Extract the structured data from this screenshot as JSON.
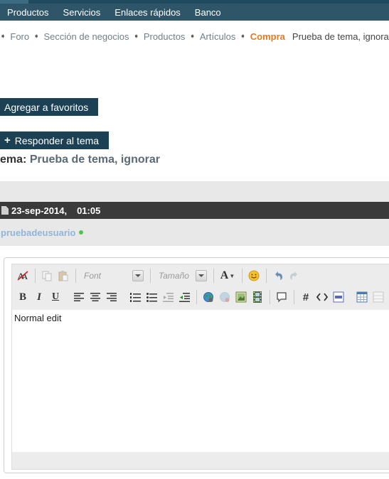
{
  "nav": {
    "items": [
      "Productos",
      "Servicios",
      "Enlaces rápidos",
      "Banco"
    ]
  },
  "breadcrumb": {
    "items": [
      "Foro",
      "Sección de negocios",
      "Productos",
      "Artículos"
    ],
    "current": "Compra",
    "page_name": "Prueba de tema, ignorar"
  },
  "actions": {
    "favorites_label": "Agregar a favoritos",
    "reply_plus": "+",
    "reply_label": "Responder al tema"
  },
  "thread": {
    "prefix": "ema:",
    "title": "Prueba de tema, ignorar"
  },
  "post": {
    "date": "23-sep-2014,",
    "time": "01:05",
    "username": "pruebadeusuario"
  },
  "editor": {
    "font_placeholder": "Font",
    "size_placeholder": "Tamaño",
    "content": "Normal edit",
    "bold_label": "B",
    "italic_label": "I",
    "underline_label": "U",
    "font_color_label": "A",
    "hash_label": "#"
  },
  "colors": {
    "nav_bg": "#2f5568",
    "button_bg": "#1c4155",
    "current_crumb": "#e8791c",
    "username": "#8fb6da",
    "online_dot": "#4fc34f",
    "post_header_bg": "#3a3a3a"
  }
}
